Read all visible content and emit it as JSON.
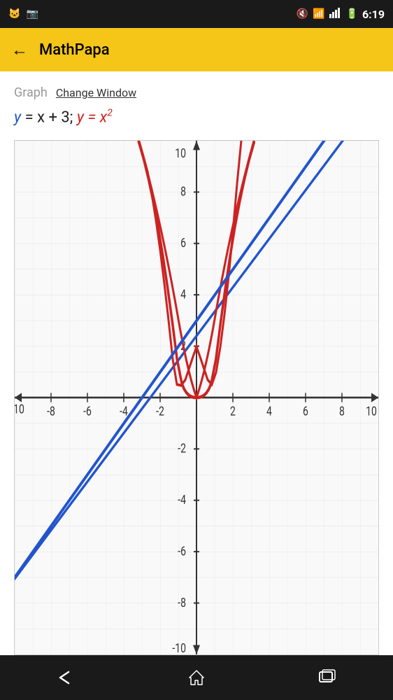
{
  "status_bar": {
    "time": "6:19",
    "icons": [
      "mute-icon",
      "wifi-icon",
      "signal-icon",
      "battery-icon"
    ]
  },
  "app_bar": {
    "back_label": "←",
    "title": "MathPapa"
  },
  "graph_header": {
    "graph_label": "Graph",
    "change_window_label": "Change Window"
  },
  "equation": {
    "part1_var": "y",
    "part1_eq": " = x + 3; ",
    "part2_var": "y",
    "part2_eq": " = x",
    "part2_exp": "2"
  },
  "graph": {
    "x_min": -10,
    "x_max": 10,
    "y_min": -10,
    "y_max": 10,
    "x_labels": [
      "-10",
      "-8",
      "-6",
      "-4",
      "-2",
      "2",
      "4",
      "6",
      "8",
      "10"
    ],
    "y_labels": [
      "10",
      "8",
      "6",
      "4",
      "2",
      "-2",
      "-4",
      "-6",
      "-8",
      "-10"
    ]
  },
  "nav_bar": {
    "back_icon": "←",
    "home_icon": "⌂",
    "recents_icon": "▭"
  }
}
